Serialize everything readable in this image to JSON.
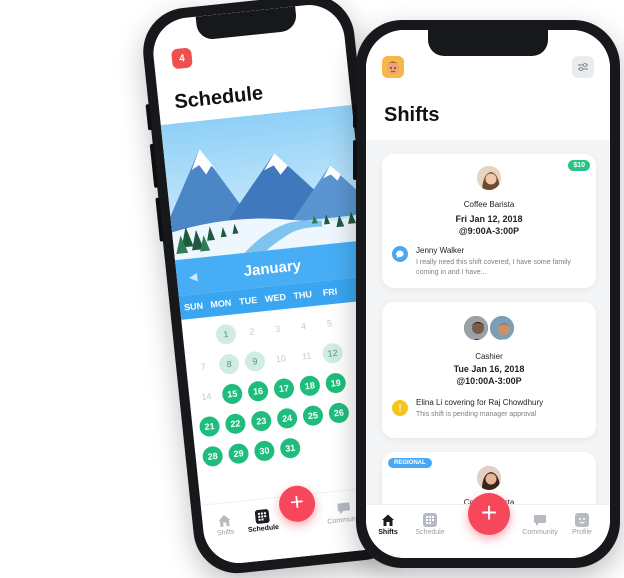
{
  "schedule_phone": {
    "notification_count": "4",
    "title": "Schedule",
    "month": "January",
    "weekdays": [
      "SUN",
      "MON",
      "TUE",
      "WED",
      "THU",
      "FRI"
    ],
    "days": [
      {
        "n": "",
        "s": "none"
      },
      {
        "n": "1",
        "s": "light"
      },
      {
        "n": "2",
        "s": "none"
      },
      {
        "n": "3",
        "s": "none"
      },
      {
        "n": "4",
        "s": "none"
      },
      {
        "n": "5",
        "s": "none"
      },
      {
        "n": "",
        "s": "none"
      },
      {
        "n": "7",
        "s": "none"
      },
      {
        "n": "8",
        "s": "light"
      },
      {
        "n": "9",
        "s": "light"
      },
      {
        "n": "10",
        "s": "none"
      },
      {
        "n": "11",
        "s": "none"
      },
      {
        "n": "12",
        "s": "light"
      },
      {
        "n": "",
        "s": "none"
      },
      {
        "n": "14",
        "s": "none"
      },
      {
        "n": "15",
        "s": "active"
      },
      {
        "n": "16",
        "s": "active"
      },
      {
        "n": "17",
        "s": "active"
      },
      {
        "n": "18",
        "s": "active"
      },
      {
        "n": "19",
        "s": "active"
      },
      {
        "n": "",
        "s": "none"
      },
      {
        "n": "21",
        "s": "active"
      },
      {
        "n": "22",
        "s": "active"
      },
      {
        "n": "23",
        "s": "active"
      },
      {
        "n": "24",
        "s": "active"
      },
      {
        "n": "25",
        "s": "active"
      },
      {
        "n": "26",
        "s": "active"
      },
      {
        "n": "",
        "s": "none"
      },
      {
        "n": "28",
        "s": "active"
      },
      {
        "n": "29",
        "s": "active"
      },
      {
        "n": "30",
        "s": "active"
      },
      {
        "n": "31",
        "s": "active"
      }
    ],
    "tabs": {
      "shifts": "Shifts",
      "schedule": "Schedule",
      "community": "Community"
    },
    "fab": "+"
  },
  "shifts_phone": {
    "title": "Shifts",
    "cards": [
      {
        "pay": "$10",
        "role": "Coffee Barista",
        "date": "Fri Jan 12, 2018",
        "time": "@9:00A-3:00P",
        "note_name": "Jenny Walker",
        "note_text": "I really need this shift covered, I have some family coming in and I have..."
      },
      {
        "role": "Cashier",
        "date": "Tue Jan 16, 2018",
        "time": "@10:00A-3:00P",
        "note_name": "Elina Li covering for Raj Chowdhury",
        "note_text": "This shift is pending manager approval"
      },
      {
        "badge": "REGIONAL",
        "role": "Coffee Barista"
      }
    ],
    "tabs": {
      "shifts": "Shifts",
      "schedule": "Schedule",
      "community": "Community",
      "profile": "Profile"
    },
    "fab": "+"
  },
  "colors": {
    "accent_green": "#1fbd7d",
    "accent_blue": "#47aef5",
    "fab_red": "#f6475b",
    "badge_red": "#f0504d",
    "warning_yellow": "#f5c518"
  }
}
